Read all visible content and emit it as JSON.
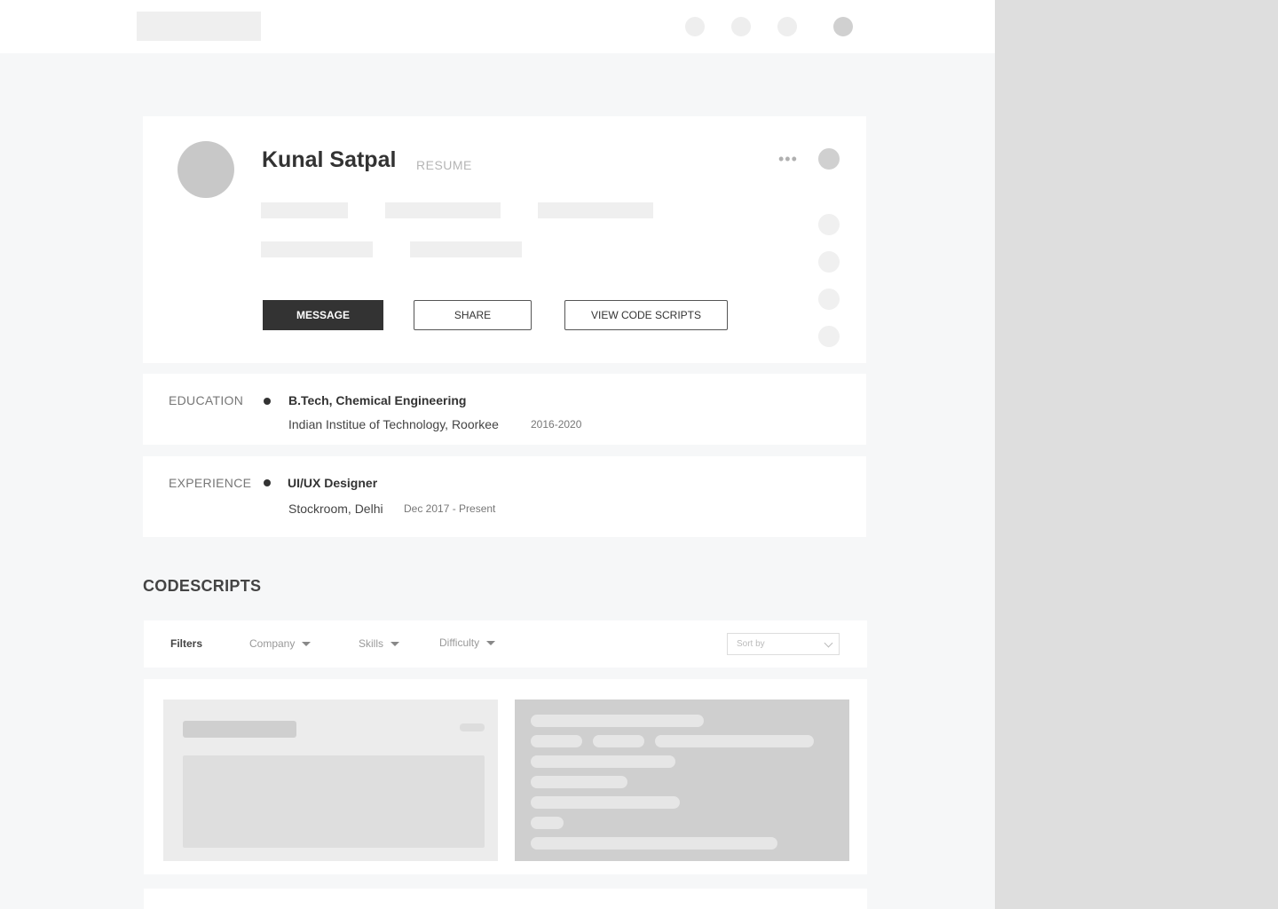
{
  "profile": {
    "name": "Kunal Satpal",
    "tag": "RESUME",
    "more_glyph": "•••",
    "actions": {
      "message": "MESSAGE",
      "share": "SHARE",
      "view_scripts": "VIEW CODE SCRIPTS"
    }
  },
  "education": {
    "label": "EDUCATION",
    "title": "B.Tech, Chemical Engineering",
    "institute": "Indian Institue of Technology, Roorkee",
    "years": "2016-2020"
  },
  "experience": {
    "label": "EXPERIENCE",
    "title": "UI/UX Designer",
    "company": "Stockroom, Delhi",
    "period": "Dec 2017 - Present"
  },
  "codescripts": {
    "title": "CODESCRIPTS",
    "filters_label": "Filters",
    "filters": [
      "Company",
      "Skills",
      "Difficulty"
    ],
    "sort_placeholder": "Sort by"
  },
  "icons": {
    "topbar": [
      "notification-icon",
      "message-icon",
      "help-icon",
      "user-avatar"
    ],
    "profile_menu": "more-icon",
    "social": [
      "social-icon-1",
      "social-icon-2",
      "social-icon-3",
      "social-icon-4"
    ]
  },
  "colors": {
    "primary_button": "#333333",
    "page_background": "#f6f7f8",
    "placeholder": "#efefef"
  }
}
